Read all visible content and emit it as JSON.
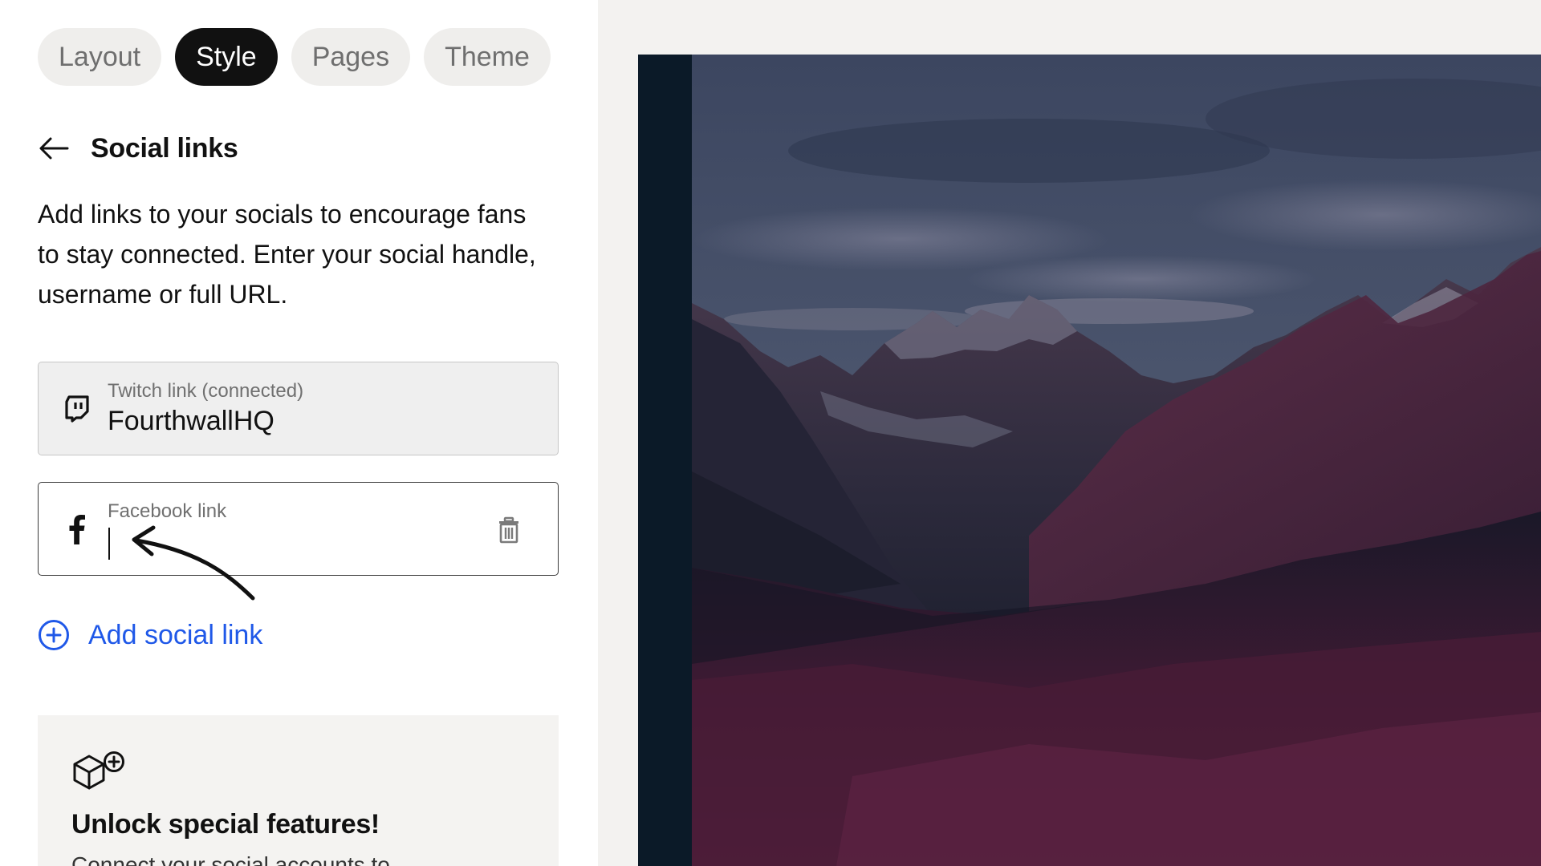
{
  "tabs": [
    {
      "label": "Layout",
      "active": false
    },
    {
      "label": "Style",
      "active": true
    },
    {
      "label": "Pages",
      "active": false
    },
    {
      "label": "Theme",
      "active": false
    }
  ],
  "section": {
    "title": "Social links",
    "description": "Add links to your socials to encourage fans to stay connected. Enter your social handle, username or full URL."
  },
  "fields": {
    "twitch": {
      "icon": "twitch-icon",
      "label": "Twitch link (connected)",
      "value": "FourthwallHQ"
    },
    "facebook": {
      "icon": "facebook-icon",
      "label": "Facebook link",
      "value": ""
    }
  },
  "add_link": {
    "label": "Add social link",
    "color": "#1f58e8"
  },
  "promo": {
    "title": "Unlock special features!",
    "text": "Connect your social accounts to"
  },
  "preview": {
    "image": "mountain-landscape-image"
  }
}
